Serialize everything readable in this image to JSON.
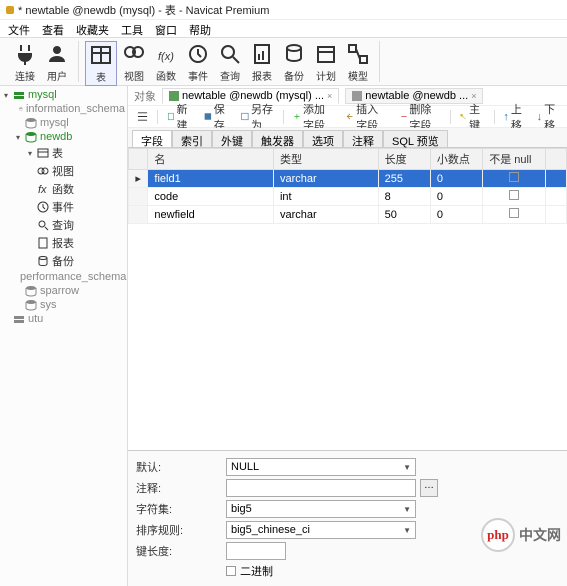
{
  "window": {
    "title": "* newtable @newdb (mysql) - 表 - Navicat Premium"
  },
  "menu": [
    "文件",
    "查看",
    "收藏夹",
    "工具",
    "窗口",
    "帮助"
  ],
  "toolbar": [
    {
      "id": "connect",
      "label": "连接"
    },
    {
      "id": "user",
      "label": "用户"
    },
    {
      "id": "table",
      "label": "表"
    },
    {
      "id": "view",
      "label": "视图"
    },
    {
      "id": "func",
      "label": "函数"
    },
    {
      "id": "event",
      "label": "事件"
    },
    {
      "id": "query",
      "label": "查询"
    },
    {
      "id": "report",
      "label": "报表"
    },
    {
      "id": "backup",
      "label": "备份"
    },
    {
      "id": "plan",
      "label": "计划"
    },
    {
      "id": "model",
      "label": "模型"
    }
  ],
  "tree": [
    {
      "lvl": 1,
      "exp": "▾",
      "ico": "srv",
      "label": "mysql",
      "color": "#2b8f2b"
    },
    {
      "lvl": 2,
      "exp": "",
      "ico": "db",
      "label": "information_schema",
      "color": "#888"
    },
    {
      "lvl": 2,
      "exp": "",
      "ico": "db",
      "label": "mysql",
      "color": "#888"
    },
    {
      "lvl": 2,
      "exp": "▾",
      "ico": "db",
      "label": "newdb",
      "color": "#2b8f2b"
    },
    {
      "lvl": 3,
      "exp": "▾",
      "ico": "tbl",
      "label": "表",
      "color": "#333"
    },
    {
      "lvl": 3,
      "exp": "",
      "ico": "vw",
      "label": "视图",
      "color": "#333"
    },
    {
      "lvl": 3,
      "exp": "",
      "ico": "fn",
      "label": "函数",
      "color": "#333"
    },
    {
      "lvl": 3,
      "exp": "",
      "ico": "ev",
      "label": "事件",
      "color": "#333"
    },
    {
      "lvl": 3,
      "exp": "",
      "ico": "qr",
      "label": "查询",
      "color": "#333"
    },
    {
      "lvl": 3,
      "exp": "",
      "ico": "rp",
      "label": "报表",
      "color": "#333"
    },
    {
      "lvl": 3,
      "exp": "",
      "ico": "bk",
      "label": "备份",
      "color": "#333"
    },
    {
      "lvl": 2,
      "exp": "",
      "ico": "db",
      "label": "performance_schema",
      "color": "#888"
    },
    {
      "lvl": 2,
      "exp": "",
      "ico": "db",
      "label": "sparrow",
      "color": "#888"
    },
    {
      "lvl": 2,
      "exp": "",
      "ico": "db",
      "label": "sys",
      "color": "#888"
    },
    {
      "lvl": 1,
      "exp": "",
      "ico": "srv",
      "label": "utu",
      "color": "#888"
    }
  ],
  "tabs": {
    "object_label": "对象",
    "tab1": "newtable @newdb (mysql) ...",
    "tab2": "newtable @newdb ..."
  },
  "actions": {
    "new": "新建",
    "save": "保存",
    "saveas": "另存为",
    "addfield": "添加字段",
    "insertfield": "插入字段",
    "deletefield": "删除字段",
    "pkey": "主键",
    "up": "上移",
    "down": "下移"
  },
  "subtabs": [
    "字段",
    "索引",
    "外键",
    "触发器",
    "选项",
    "注释",
    "SQL 预览"
  ],
  "columns": {
    "name": "名",
    "type": "类型",
    "len": "长度",
    "dec": "小数点",
    "notnull": "不是 null",
    "key": ""
  },
  "rows": [
    {
      "name": "field1",
      "type": "varchar",
      "len": "255",
      "dec": "0",
      "notnull": true,
      "selected": true
    },
    {
      "name": "code",
      "type": "int",
      "len": "8",
      "dec": "0",
      "notnull": false,
      "selected": false
    },
    {
      "name": "newfield",
      "type": "varchar",
      "len": "50",
      "dec": "0",
      "notnull": false,
      "selected": false
    }
  ],
  "form": {
    "default_lbl": "默认:",
    "default_val": "NULL",
    "comment_lbl": "注释:",
    "comment_val": "",
    "charset_lbl": "字符集:",
    "charset_val": "big5",
    "collate_lbl": "排序规则:",
    "collate_val": "big5_chinese_ci",
    "keylen_lbl": "键长度:",
    "keylen_val": "",
    "binary_lbl": "二进制"
  },
  "watermark": {
    "logo": "php",
    "text": "中文网"
  }
}
